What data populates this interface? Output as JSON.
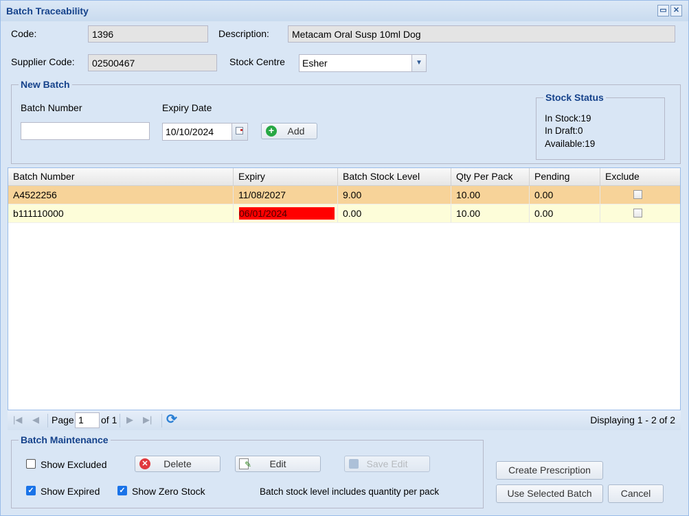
{
  "window": {
    "title": "Batch Traceability",
    "maximize_icon": "maximize-icon",
    "close_icon": "close-icon"
  },
  "form": {
    "code_label": "Code:",
    "code_value": "1396",
    "description_label": "Description:",
    "description_value": "Metacam Oral Susp 10ml Dog",
    "supplier_code_label": "Supplier Code:",
    "supplier_code_value": "02500467",
    "stock_centre_label": "Stock Centre",
    "stock_centre_value": "Esher"
  },
  "new_batch": {
    "legend": "New Batch",
    "batch_number_label": "Batch Number",
    "batch_number_value": "",
    "expiry_date_label": "Expiry Date",
    "expiry_date_value": "10/10/2024",
    "add_label": "Add"
  },
  "stock_status": {
    "legend": "Stock Status",
    "in_stock": "In Stock:19",
    "in_draft": "In Draft:0",
    "available": "Available:19"
  },
  "grid": {
    "columns": [
      "Batch Number",
      "Expiry",
      "Batch Stock Level",
      "Qty Per Pack",
      "Pending",
      "Exclude"
    ],
    "rows": [
      {
        "batch": "A4522256",
        "expiry": "11/08/2027",
        "level": "9.00",
        "qty": "10.00",
        "pending": "0.00",
        "exclude": false,
        "selected": true,
        "expired": false
      },
      {
        "batch": "b111110000",
        "expiry": "06/01/2024",
        "level": "0.00",
        "qty": "10.00",
        "pending": "0.00",
        "exclude": false,
        "selected": false,
        "expired": true
      }
    ]
  },
  "pager": {
    "page_label": "Page",
    "page_value": "1",
    "of_label": "of 1",
    "display_text": "Displaying 1 - 2 of 2"
  },
  "maintenance": {
    "legend": "Batch Maintenance",
    "show_excluded": "Show Excluded",
    "show_excluded_checked": false,
    "show_expired": "Show Expired",
    "show_expired_checked": true,
    "show_zero_stock": "Show Zero Stock",
    "show_zero_stock_checked": true,
    "delete_label": "Delete",
    "edit_label": "Edit",
    "save_edit_label": "Save Edit",
    "note": "Batch stock level includes quantity per pack"
  },
  "actions": {
    "create_prescription": "Create Prescription",
    "use_selected_batch": "Use Selected Batch",
    "cancel": "Cancel"
  },
  "colors": {
    "selected_row": "#f7d399",
    "alt_row": "#fdfdd9",
    "expired_cell": "#ff0000",
    "accent": "#15428b"
  }
}
